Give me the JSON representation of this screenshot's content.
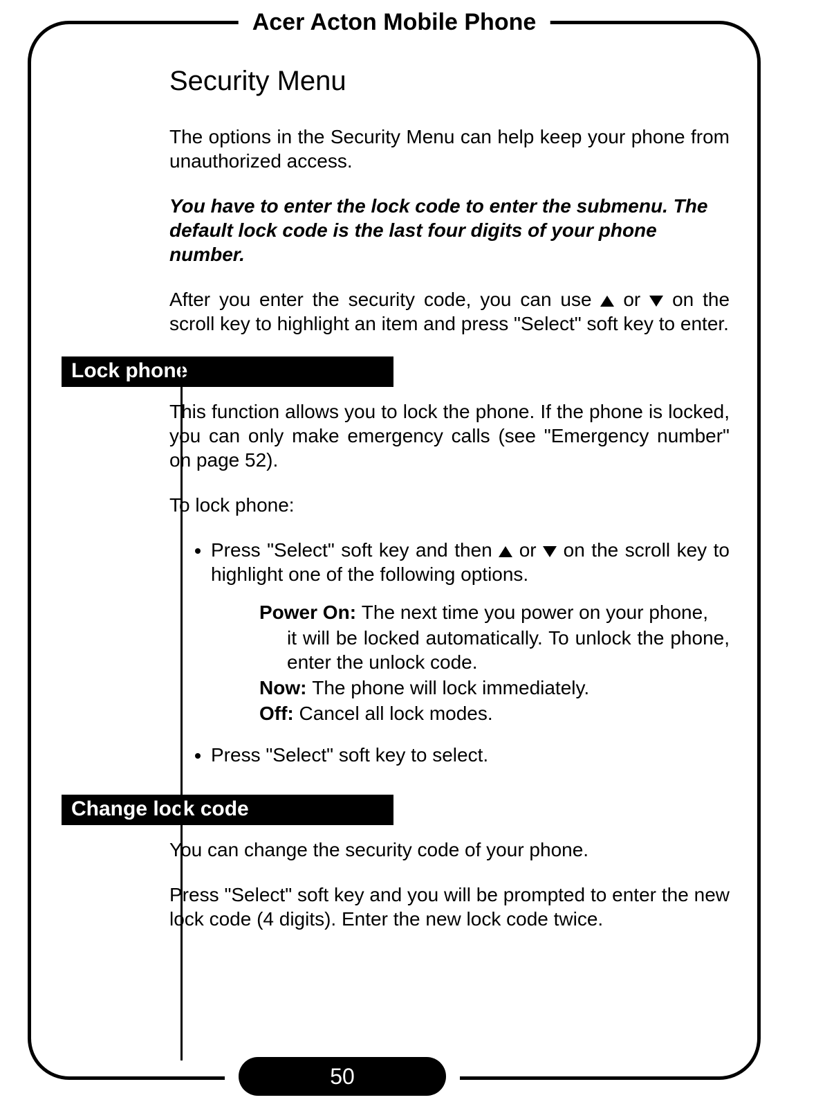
{
  "header": "Acer Acton Mobile Phone",
  "title": "Security Menu",
  "intro": "The options in the Security Menu can help keep your phone from unauthorized access.",
  "note": "You have to enter the lock code to enter the submenu. The default lock code is the last four digits of your phone number.",
  "after1": "After you enter the security code, you can use ",
  "after2": " or ",
  "after3": " on the scroll key to highlight an item and press \"Select\" soft key to enter.",
  "lock": {
    "heading": "Lock phone",
    "p1": "This function allows you to lock the phone. If the phone is locked, you can only make emergency calls (see \"Emergency number\" on page 52).",
    "p2": "To lock phone:",
    "b1a": "Press \"Select\" soft key and then ",
    "b1b": " or ",
    "b1c": " on the scroll key to highlight one of the following options.",
    "opt1_label": "Power On: ",
    "opt1_text": "The next time you power on your phone,",
    "opt1_cont": "it will be locked automatically. To unlock the phone, enter the unlock code.",
    "opt2_label": "Now: ",
    "opt2_text": "The phone will lock immediately.",
    "opt3_label": "Off: ",
    "opt3_text": "Cancel all lock modes.",
    "b2": "Press \"Select\" soft key to select."
  },
  "change": {
    "heading": "Change lock code",
    "p1": "You can change the security code of your phone.",
    "p2": "Press \"Select\" soft key and you will be prompted to enter the new lock code (4 digits). Enter the new lock code twice."
  },
  "page_number": "50"
}
